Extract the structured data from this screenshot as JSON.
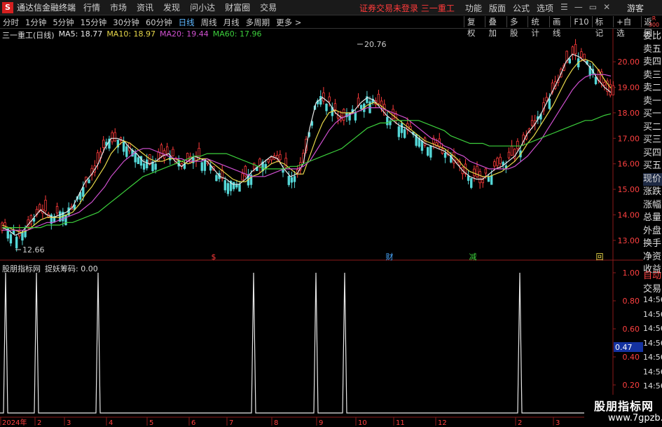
{
  "menubar": {
    "logo": "S",
    "app_title": "通达信金融终端",
    "items": [
      "行情",
      "市场",
      "资讯",
      "发现",
      "问小达",
      "财富圈",
      "交易"
    ],
    "status_text": "证券交易未登录  三一重工",
    "right_items": [
      "功能",
      "版面",
      "公式",
      "选项"
    ],
    "window_controls": [
      "☰",
      "—",
      "▭",
      "✕"
    ],
    "user": "游客"
  },
  "periodbar": {
    "periods": [
      "分时",
      "1分钟",
      "5分钟",
      "15分钟",
      "30分钟",
      "60分钟",
      "日线",
      "周线",
      "月线",
      "多周期",
      "更多 >"
    ],
    "active_period": "日线",
    "tools": [
      "复权",
      "叠加",
      "多股",
      "统计",
      "画线",
      "F10",
      "标记",
      "+自选",
      "返回"
    ],
    "badge_top": "R",
    "badge_bottom": "300"
  },
  "chart": {
    "stock_title": "三一重工(日线)",
    "ma5_text": "MA5: 18.77",
    "ma10_text": "MA10: 18.97",
    "ma20_text": "MA20: 19.44",
    "ma60_text": "MA60: 17.96",
    "high_label": "20.76",
    "low_label": "12.66",
    "y_ticks": [
      "20.00",
      "19.00",
      "18.00",
      "17.00",
      "16.00",
      "15.00",
      "14.00",
      "13.00"
    ],
    "event_marks": [
      {
        "label": "$",
        "color": "#ff3b3b"
      },
      {
        "label": "财",
        "color": "#4aa8ff"
      },
      {
        "label": "减",
        "color": "#3ccf3c"
      },
      {
        "label": "回",
        "color": "#e8d84a"
      }
    ]
  },
  "orderbook": [
    "委比",
    "卖五",
    "卖四",
    "卖三",
    "卖二",
    "卖一",
    "买一",
    "买二",
    "买三",
    "买四",
    "买五",
    "现价",
    "涨跌",
    "涨幅",
    "总量",
    "外盘",
    "换手",
    "净资",
    "收益"
  ],
  "indicator": {
    "name": "股朋指标网",
    "label": "捉妖筹码: 0.00",
    "y_ticks": [
      "1.00",
      "0.80",
      "0.60",
      "0.40",
      "0.20"
    ],
    "current_value": "0.47",
    "right_header_1": "自动",
    "right_header_2": "交易",
    "right_times": [
      "14:56",
      "14:56",
      "14:56",
      "14:56",
      "14:56",
      "14:56",
      "14:56",
      "14:56",
      "14:56"
    ]
  },
  "x_axis": {
    "labels": [
      "2024年",
      "2",
      "3",
      "4",
      "5",
      "6",
      "7",
      "8",
      "9",
      "10",
      "11",
      "12",
      "2",
      "3"
    ]
  },
  "watermark": {
    "line1": "股朋指标网",
    "line2": "www.7gpzb.com"
  },
  "colors": {
    "ma5": "#e8e8e8",
    "ma10": "#e8d84a",
    "ma20": "#d050d0",
    "ma60": "#3ccf3c",
    "up": "#ff3b3b",
    "down": "#54d6d6",
    "axis": "#8b1a1a"
  },
  "chart_data": {
    "type": "line",
    "ylim": [
      12.5,
      20.8
    ],
    "series": [
      {
        "name": "MA5",
        "values": [
          13.5,
          13.4,
          13.2,
          13.3,
          13.6,
          13.9,
          14.2,
          14.0,
          13.9,
          14.0,
          14.1,
          14.3,
          14.8,
          15.3,
          15.6,
          16.0,
          16.6,
          17.0,
          17.0,
          16.9,
          16.6,
          16.4,
          16.1,
          16.0,
          16.1,
          16.3,
          16.4,
          16.1,
          15.9,
          16.1,
          16.3,
          16.2,
          16.1,
          15.8,
          15.5,
          15.4,
          15.2,
          15.2,
          15.4,
          15.7,
          15.9,
          16.1,
          16.3,
          16.2,
          15.8,
          15.5,
          15.6,
          16.0,
          17.4,
          18.4,
          18.6,
          18.4,
          18.0,
          17.8,
          17.9,
          18.1,
          18.4,
          18.6,
          18.5,
          18.2,
          17.9,
          17.7,
          17.5,
          17.4,
          17.2,
          17.0,
          16.8,
          16.7,
          16.6,
          16.5,
          16.3,
          16.0,
          15.7,
          15.5,
          15.4,
          15.4,
          15.6,
          15.8,
          15.9,
          16.1,
          16.3,
          16.7,
          17.2,
          17.5,
          17.9,
          18.4,
          18.9,
          19.4,
          20.0,
          20.3,
          20.2,
          20.0,
          19.7,
          19.3,
          19.0,
          18.8
        ]
      },
      {
        "name": "MA10",
        "values": [
          13.6,
          13.5,
          13.4,
          13.3,
          13.4,
          13.6,
          13.8,
          13.9,
          13.9,
          13.9,
          14.0,
          14.1,
          14.4,
          14.8,
          15.1,
          15.5,
          15.9,
          16.4,
          16.7,
          16.9,
          16.8,
          16.6,
          16.4,
          16.2,
          16.1,
          16.1,
          16.2,
          16.2,
          16.1,
          16.0,
          16.1,
          16.2,
          16.2,
          16.0,
          15.8,
          15.6,
          15.4,
          15.3,
          15.3,
          15.5,
          15.6,
          15.8,
          16.0,
          16.1,
          16.0,
          15.8,
          15.6,
          15.6,
          16.3,
          17.0,
          17.6,
          18.0,
          18.1,
          18.0,
          18.0,
          18.0,
          18.1,
          18.3,
          18.4,
          18.3,
          18.1,
          17.9,
          17.7,
          17.5,
          17.3,
          17.1,
          16.9,
          16.8,
          16.7,
          16.6,
          16.4,
          16.2,
          15.9,
          15.7,
          15.6,
          15.5,
          15.5,
          15.6,
          15.7,
          15.9,
          16.1,
          16.4,
          16.8,
          17.1,
          17.5,
          17.9,
          18.3,
          18.8,
          19.3,
          19.7,
          20.0,
          20.1,
          20.0,
          19.7,
          19.3,
          18.97
        ]
      },
      {
        "name": "MA20",
        "values": [
          13.4,
          13.4,
          13.4,
          13.4,
          13.4,
          13.5,
          13.6,
          13.7,
          13.7,
          13.8,
          13.9,
          14.0,
          14.1,
          14.3,
          14.5,
          14.8,
          15.1,
          15.5,
          15.8,
          16.1,
          16.3,
          16.5,
          16.6,
          16.6,
          16.5,
          16.4,
          16.3,
          16.2,
          16.2,
          16.1,
          16.1,
          16.1,
          16.2,
          16.1,
          16.0,
          15.9,
          15.8,
          15.7,
          15.6,
          15.5,
          15.5,
          15.5,
          15.6,
          15.7,
          15.8,
          15.8,
          15.8,
          15.9,
          16.1,
          16.5,
          16.9,
          17.3,
          17.6,
          17.8,
          17.9,
          18.0,
          18.1,
          18.2,
          18.2,
          18.2,
          18.1,
          18.0,
          17.9,
          17.8,
          17.6,
          17.4,
          17.2,
          17.0,
          16.9,
          16.7,
          16.6,
          16.4,
          16.3,
          16.1,
          16.0,
          15.9,
          15.8,
          15.8,
          15.8,
          15.8,
          15.9,
          16.1,
          16.3,
          16.6,
          16.9,
          17.3,
          17.7,
          18.1,
          18.5,
          18.9,
          19.2,
          19.4,
          19.5,
          19.5,
          19.5,
          19.44
        ]
      },
      {
        "name": "MA60",
        "values": [
          13.5,
          13.5,
          13.5,
          13.5,
          13.5,
          13.5,
          13.5,
          13.6,
          13.6,
          13.6,
          13.7,
          13.7,
          13.8,
          13.9,
          14.0,
          14.1,
          14.3,
          14.5,
          14.7,
          14.9,
          15.1,
          15.3,
          15.5,
          15.6,
          15.7,
          15.8,
          15.9,
          16.0,
          16.1,
          16.2,
          16.3,
          16.3,
          16.4,
          16.4,
          16.4,
          16.4,
          16.3,
          16.2,
          16.1,
          16.0,
          15.9,
          15.8,
          15.8,
          15.8,
          15.8,
          15.9,
          15.9,
          16.0,
          16.1,
          16.2,
          16.3,
          16.4,
          16.5,
          16.6,
          16.8,
          17.0,
          17.2,
          17.4,
          17.5,
          17.6,
          17.6,
          17.7,
          17.7,
          17.7,
          17.7,
          17.7,
          17.6,
          17.5,
          17.4,
          17.3,
          17.1,
          17.0,
          16.9,
          16.8,
          16.8,
          16.8,
          16.7,
          16.7,
          16.7,
          16.7,
          16.7,
          16.7,
          16.8,
          16.9,
          17.0,
          17.1,
          17.2,
          17.3,
          17.4,
          17.5,
          17.6,
          17.7,
          17.7,
          17.8,
          17.9,
          17.96
        ]
      }
    ],
    "indicator_spikes": [
      8,
      52,
      140,
      362,
      451,
      492,
      742
    ]
  }
}
